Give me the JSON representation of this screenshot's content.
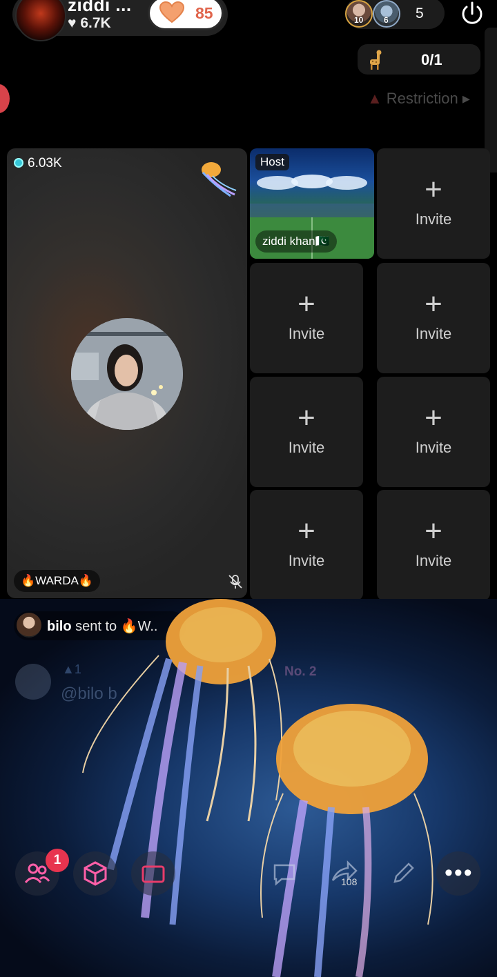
{
  "header": {
    "host_name": "ziddi ...",
    "host_likes": "6.7K",
    "follow_count": "85",
    "viewer_badges": [
      "10",
      "6"
    ],
    "viewer_count": "5",
    "power_icon": "power-icon"
  },
  "gift_goal": {
    "icon": "giraffe-icon",
    "count": "0/1"
  },
  "restriction": {
    "label": "Restriction"
  },
  "main_seat": {
    "coins": "6.03K",
    "name": "🔥WARDA🔥",
    "mic_state": "muted"
  },
  "host_seat": {
    "tag": "Host",
    "name": "ziddi khan🇵🇰"
  },
  "invite_cells": [
    {
      "plus": "+",
      "label": "Invite"
    },
    {
      "plus": "+",
      "label": "Invite"
    },
    {
      "plus": "+",
      "label": "Invite"
    },
    {
      "plus": "+",
      "label": "Invite"
    },
    {
      "plus": "+",
      "label": "Invite"
    },
    {
      "plus": "+",
      "label": "Invite"
    },
    {
      "plus": "+",
      "label": "Invite"
    }
  ],
  "chat": {
    "sender": "bilo",
    "message": " sent to 🔥W..",
    "ghost_rank": "No. 2",
    "ghost_level": "▲1",
    "ghost_handle": "@bilo b"
  },
  "toolbar": {
    "notification_badge": "1",
    "share_count": "108",
    "more_label": "•••"
  },
  "colors": {
    "accent_follow": "#e0654c",
    "badge_red": "#e8344f",
    "coin": "#35c7d9"
  }
}
